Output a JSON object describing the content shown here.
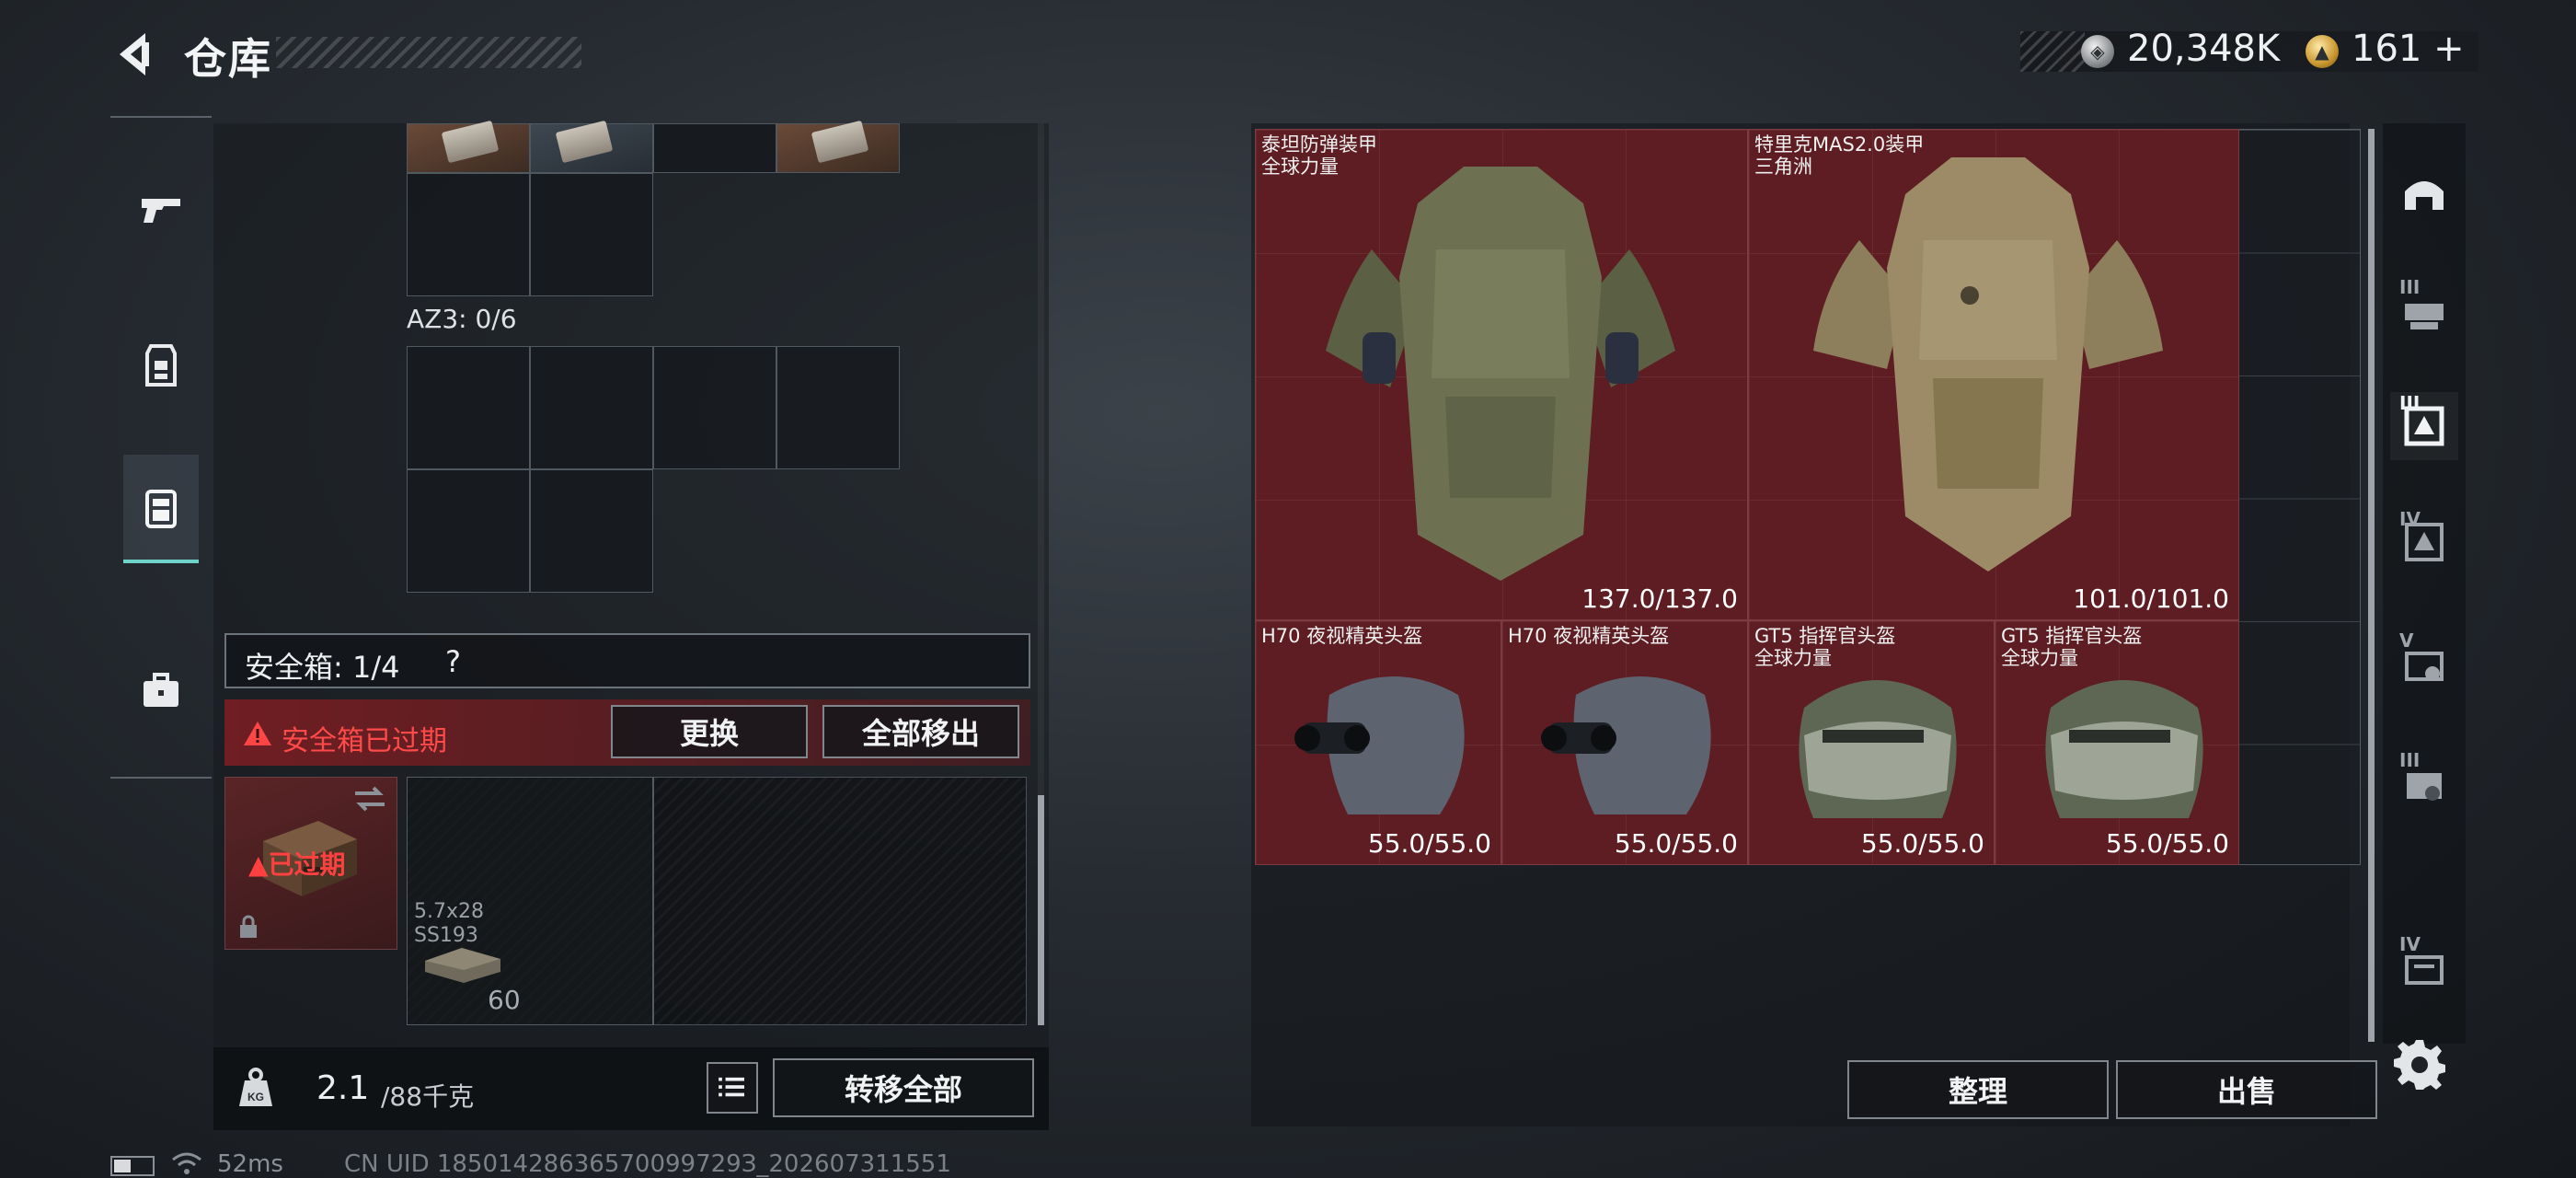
{
  "header": {
    "title": "仓库",
    "money": "20,348K",
    "gold": "161",
    "gold_plus": "+"
  },
  "left_tabs": [
    {
      "name": "weapons-tab",
      "icon": "pistol-icon"
    },
    {
      "name": "equipment-tab",
      "icon": "armor-rig-icon"
    },
    {
      "name": "backpack-tab",
      "icon": "backpack-icon",
      "active": true
    },
    {
      "name": "case-tab",
      "icon": "briefcase-icon"
    }
  ],
  "container": {
    "section_label": "AZ3: 0/6"
  },
  "safe_box": {
    "label": "安全箱: 1/4",
    "help": "?",
    "expired_notice": "安全箱已过期",
    "replace_button": "更换",
    "move_all_button": "全部移出",
    "expired_badge": "已过期",
    "ammo": {
      "name": "5.7x28 SS193",
      "count": "60"
    }
  },
  "bottom_left": {
    "weight_current": "2.1",
    "weight_max": "/88千克",
    "transfer_button": "转移全部"
  },
  "stash_items": [
    {
      "name": "泰坦防弹装甲",
      "sub": "全球力量",
      "durability": "137.0/137.0",
      "kind": "armor",
      "color": "#5d1d22"
    },
    {
      "name": "特里克MAS2.0装甲",
      "sub": "三角洲",
      "durability": "101.0/101.0",
      "kind": "armor-camo",
      "color": "#5d1d22"
    },
    {
      "name": "H70 夜视精英头盔",
      "sub": "",
      "durability": "55.0/55.0",
      "kind": "nv-helmet"
    },
    {
      "name": "H70 夜视精英头盔",
      "sub": "",
      "durability": "55.0/55.0",
      "kind": "nv-helmet"
    },
    {
      "name": "GT5 指挥官头盔",
      "sub": "全球力量",
      "durability": "55.0/55.0",
      "kind": "visor-helmet"
    },
    {
      "name": "GT5 指挥官头盔",
      "sub": "全球力量",
      "durability": "55.0/55.0",
      "kind": "visor-helmet"
    }
  ],
  "right_actions": {
    "sort_button": "整理",
    "sell_button": "出售"
  },
  "right_tabs": [
    {
      "name": "tab-helmet-all",
      "tier": ""
    },
    {
      "name": "tab-tier-III-rig",
      "tier": "III"
    },
    {
      "name": "tab-tier-III-armor",
      "tier": "III"
    },
    {
      "name": "tab-tier-IV-armor",
      "tier": "IV"
    },
    {
      "name": "tab-tier-V-helmet",
      "tier": "V"
    },
    {
      "name": "tab-tier-III-helmet",
      "tier": "III"
    },
    {
      "name": "tab-tier-IV-case",
      "tier": "IV"
    }
  ],
  "status_bar": {
    "ping": "52ms",
    "uid": "CN UID 18501428636570099729З_202607311551"
  }
}
